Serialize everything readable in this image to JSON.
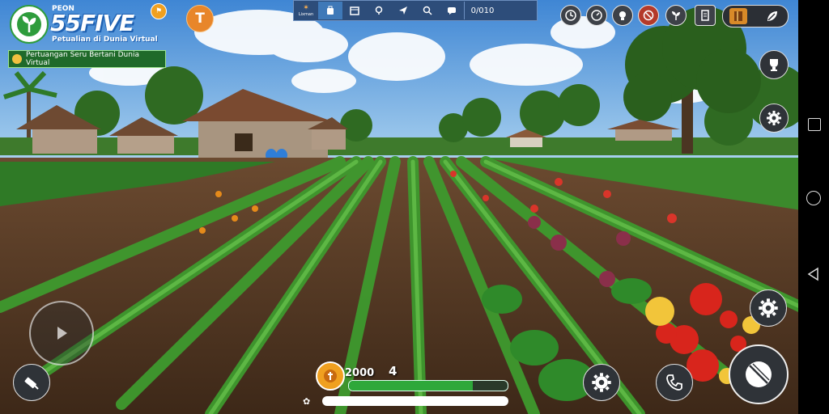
{
  "logo": {
    "small": "PEON",
    "title": "55FIVE",
    "tagline": "Petualian di Dunia Virtual",
    "banner": "Pertuangan Seru Bertani Dunia Virtual"
  },
  "top_toolbar": {
    "first_label": "Lixman",
    "counter": "0/010"
  },
  "bottom_hud": {
    "coin_value": "2000",
    "level_number": "4",
    "xp_progress_fraction": 0.78,
    "stamina_fraction": 1.0
  },
  "colors": {
    "logo_green": "#2e9c3c",
    "accent_orange": "#e8862a",
    "toolbar_bg": "#2d4d7a",
    "xp_green": "#2ea83a"
  },
  "icons": {
    "top_right": [
      "clock-icon",
      "speedometer-icon",
      "bulb-icon",
      "no-entry-icon",
      "sprout-icon",
      "document-icon",
      "book-icon",
      "leaf-icon"
    ],
    "right_side": [
      "trophy-icon",
      "settings-gear-icon"
    ],
    "bottom_right": [
      "settings-gear-icon",
      "phone-icon",
      "tool-action-icon"
    ],
    "left": [
      "joystick-icon",
      "shovel-icon"
    ]
  }
}
